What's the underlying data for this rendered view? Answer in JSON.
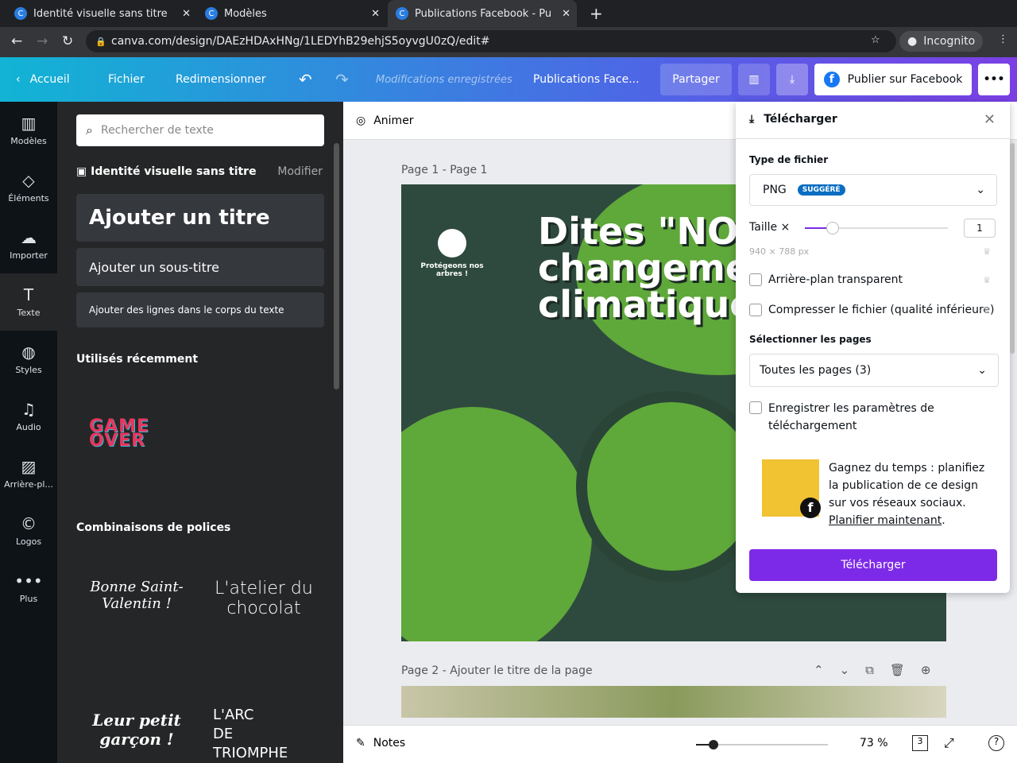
{
  "browser": {
    "tabs": [
      {
        "title": "Identité visuelle sans titre"
      },
      {
        "title": "Modèles"
      },
      {
        "title": "Publications Facebook - Pu"
      }
    ],
    "url": "canva.com/design/DAEzHDAxHNg/1LEDYhB29ehjS5oyvgU0zQ/edit#",
    "profile": "Incognito"
  },
  "topbar": {
    "home": "Accueil",
    "file": "Fichier",
    "resize": "Redimensionner",
    "saved": "Modifications enregistrées",
    "doc_title": "Publications Face...",
    "share": "Partager",
    "publish": "Publier sur Facebook"
  },
  "rail": [
    {
      "label": "Modèles",
      "icon": "▥"
    },
    {
      "label": "Éléments",
      "icon": "◇"
    },
    {
      "label": "Importer",
      "icon": "☁"
    },
    {
      "label": "Texte",
      "icon": "T"
    },
    {
      "label": "Styles",
      "icon": "◍"
    },
    {
      "label": "Audio",
      "icon": "♫"
    },
    {
      "label": "Arrière-pl...",
      "icon": "▨"
    },
    {
      "label": "Logos",
      "icon": "©"
    },
    {
      "label": "Plus",
      "icon": "•••"
    }
  ],
  "panel": {
    "search_placeholder": "Rechercher de texte",
    "brand": "Identité visuelle sans titre",
    "modify": "Modifier",
    "add_title": "Ajouter un titre",
    "add_subtitle": "Ajouter un sous-titre",
    "add_body": "Ajouter des lignes dans le corps du texte",
    "recent": "Utilisés récemment",
    "recent_item": "GAME OVER",
    "combos": "Combinaisons de polices",
    "combo_items": [
      "Bonne Saint-Valentin !",
      "L'atelier du chocolat",
      "Leur petit garçon !",
      "L'ARC DE TRIOMPHE"
    ]
  },
  "canvas": {
    "animate": "Animer",
    "page1_label": "Page 1 - Page 1",
    "poster_title": "Dites \"NON\" au changement climatique",
    "poster_logo": "Protégeons nos arbres !",
    "page2_label": "Page 2 - Ajouter le titre de la page",
    "notes": "Notes",
    "zoom": "73 %",
    "page_count": "3"
  },
  "download": {
    "title": "Télécharger",
    "file_type_label": "Type de fichier",
    "file_type": "PNG",
    "badge": "SUGGÉRÉ",
    "size_label": "Taille ×",
    "size_value": "1",
    "size_fraction": 0.1,
    "dimensions": "940 × 788 px",
    "transparent": "Arrière-plan transparent",
    "compress": "Compresser le fichier (qualité inférieure)",
    "pages_label": "Sélectionner les pages",
    "pages_value": "Toutes les pages (3)",
    "save_settings": "Enregistrer les paramètres de téléchargement",
    "promo_text": "Gagnez du temps : planifiez la publication de ce design sur vos réseaux sociaux.",
    "promo_link": "Planifier maintenant",
    "button": "Télécharger"
  }
}
